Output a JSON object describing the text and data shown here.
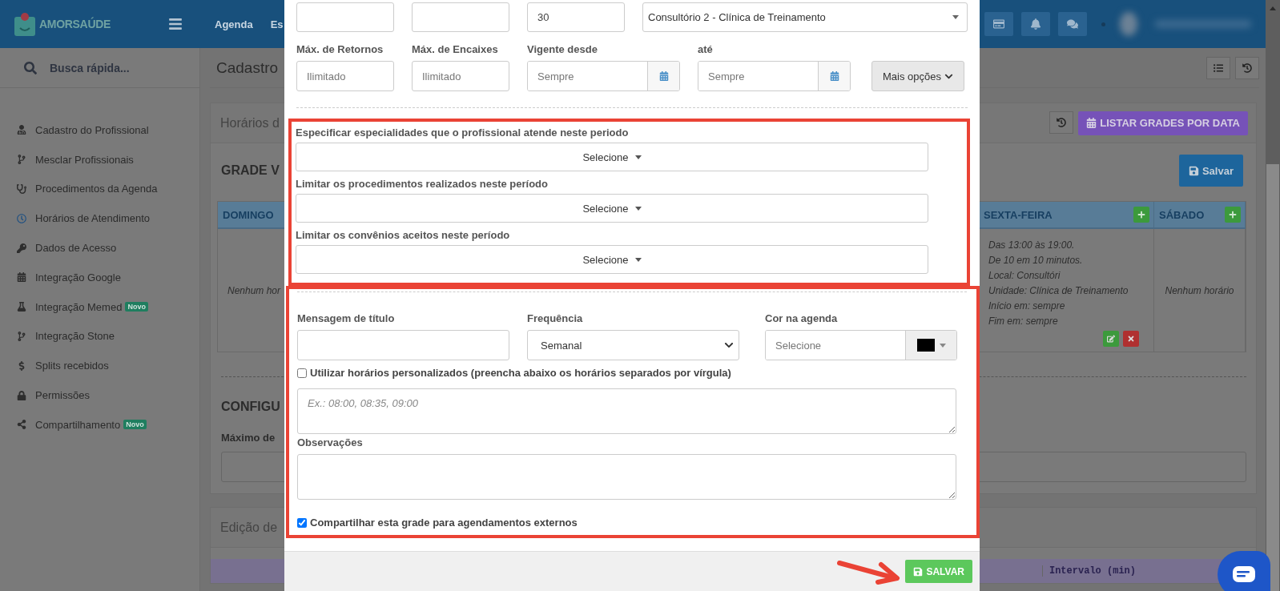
{
  "header": {
    "brand": "AMORSAÚDE",
    "nav": [
      "Agenda",
      "Es"
    ]
  },
  "sidebar": {
    "search_placeholder": "Busca rápida...",
    "items": [
      {
        "label": "Cadastro do Profissional",
        "selected": false
      },
      {
        "label": "Mesclar Profissionais",
        "selected": false
      },
      {
        "label": "Procedimentos da Agenda",
        "selected": false
      },
      {
        "label": "Horários de Atendimento",
        "selected": true
      },
      {
        "label": "Dados de Acesso",
        "selected": false
      },
      {
        "label": "Integração Google",
        "selected": false
      },
      {
        "label": "Integração Memed",
        "selected": false,
        "badge": "Novo"
      },
      {
        "label": "Integração Stone",
        "selected": false
      },
      {
        "label": "Splits recebidos",
        "selected": false
      },
      {
        "label": "Permissões",
        "selected": false
      },
      {
        "label": "Compartilhamento",
        "selected": false,
        "badge": "Novo"
      }
    ]
  },
  "page": {
    "title": "Cadastro"
  },
  "schedule_card": {
    "title": "Horários d",
    "list_button": "LISTAR GRADES POR DATA",
    "section_title": "GRADE V",
    "save_button": "Salvar",
    "columns": [
      {
        "day": "DOMINGO",
        "empty": "Nenhum hor"
      },
      {
        "day": "SEXTA-FEIRA",
        "add_button": true,
        "lines": [
          "Das 13:00 às 19:00.",
          "De 10 em 10 minutos.",
          "Local: Consultóri",
          "Unidade: Clínica de Treinamento",
          "Início em: sempre",
          "Fim em: sempre"
        ]
      },
      {
        "day": "SÁBADO",
        "add_button": true,
        "empty": "Nenhum horário"
      }
    ],
    "config_title": "CONFIGU",
    "config_label": "Máximo de"
  },
  "edit_card": {
    "title": "Edição de",
    "column": "Intervalo (min)"
  },
  "modal": {
    "top_inputs": [
      {
        "kind": "blank"
      },
      {
        "kind": "blank"
      },
      {
        "kind": "filled",
        "value": "30"
      }
    ],
    "location_select": "Consultório 2 - Clínica de Treinamento",
    "limit_fields": [
      {
        "label": "Máx. de Retornos",
        "placeholder": "Ilimitado",
        "kind": "text"
      },
      {
        "label": "Máx. de Encaixes",
        "placeholder": "Ilimitado",
        "kind": "text"
      },
      {
        "label": "Vigente desde",
        "placeholder": "Sempre",
        "kind": "date"
      },
      {
        "label": "até",
        "placeholder": "Sempre",
        "kind": "date"
      }
    ],
    "more_button": "Mais opções",
    "filters": [
      {
        "label": "Especificar especialidades que o profissional atende neste periodo",
        "value": "Selecione"
      },
      {
        "label": "Limitar os procedimentos realizados neste período",
        "value": "Selecione"
      },
      {
        "label": "Limitar os convênios aceitos neste período",
        "value": "Selecione"
      }
    ],
    "title_field": {
      "label": "Mensagem de título"
    },
    "frequency": {
      "label": "Frequência",
      "value": "Semanal"
    },
    "color_field": {
      "label": "Cor na agenda",
      "placeholder": "Selecione",
      "color": "#000000"
    },
    "custom_times": {
      "label": "Utilizar horários personalizados (preencha abaixo os horários separados por vírgula)",
      "checked": false,
      "placeholder": "Ex.: 08:00, 08:35, 09:00"
    },
    "notes": {
      "label": "Observações"
    },
    "share": {
      "label": "Compartilhar esta grade para agendamentos externos",
      "checked": true
    },
    "save_button": "SALVAR"
  }
}
